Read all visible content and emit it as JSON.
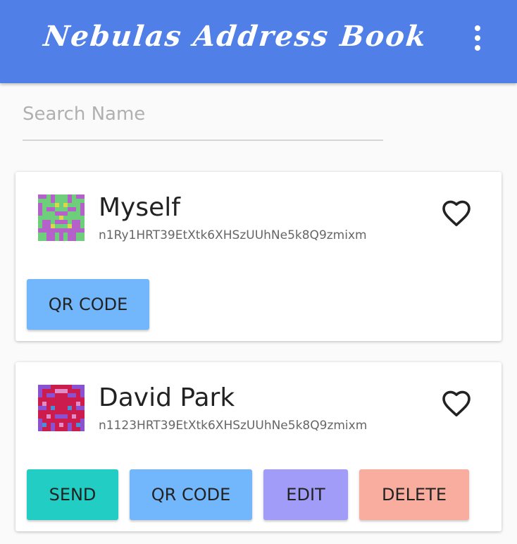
{
  "app": {
    "title": "Nebulas Address Book",
    "menu_icon": "more-vert-icon",
    "bar_color": "#4f7fe7"
  },
  "search": {
    "placeholder": "Search Name",
    "value": ""
  },
  "contacts": [
    {
      "name": "Myself",
      "address": "n1Ry1HRT39EtXtk6XHSzUUhNe5k8Q9zmixm",
      "favorite": false,
      "favorite_icon": "heart-outline-icon",
      "avatar_icon": "identicon-avatar",
      "buttons": {
        "qr_code": "QR CODE"
      }
    },
    {
      "name": "David Park",
      "address": "n1123HRT39EtXtk6XHSzUUhNe5k8Q9zmixm",
      "favorite": false,
      "favorite_icon": "heart-outline-icon",
      "avatar_icon": "identicon-avatar",
      "buttons": {
        "send": "SEND",
        "qr_code": "QR CODE",
        "edit": "EDIT",
        "delete": "DELETE"
      }
    }
  ],
  "colors": {
    "send": "#22cdc3",
    "qr_code": "#72b6fb",
    "edit": "#a19cf7",
    "delete": "#f8ad9f"
  }
}
